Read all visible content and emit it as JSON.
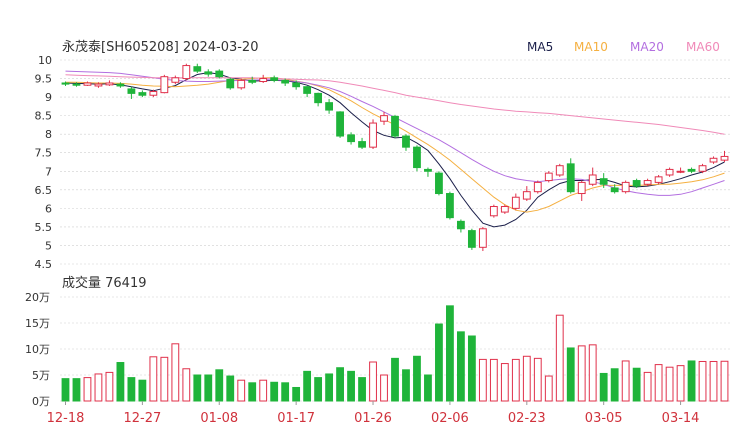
{
  "header": {
    "title": "永茂泰[SH605208] 2024-03-20"
  },
  "legend": [
    {
      "label": "MA5",
      "color": "#1b1f4a"
    },
    {
      "label": "MA10",
      "color": "#f5b041"
    },
    {
      "label": "MA20",
      "color": "#b36fe0"
    },
    {
      "label": "MA60",
      "color": "#f08ab8"
    }
  ],
  "volume_title": "成交量 76419",
  "colors": {
    "up": "#e0304a",
    "down": "#1fb43a",
    "grid": "#cfcfcf",
    "axis_text": "#333333",
    "date_text": "#d0323c"
  },
  "chart_data": [
    {
      "type": "candlestick",
      "ylim": [
        4.5,
        10
      ],
      "y_ticks": [
        "10",
        "9.5",
        "9",
        "8.5",
        "8",
        "7.5",
        "7",
        "6.5",
        "6",
        "5.5",
        "5",
        "4.5"
      ],
      "x_labels": [
        {
          "i": 0,
          "label": "12-18"
        },
        {
          "i": 7,
          "label": "12-27"
        },
        {
          "i": 14,
          "label": "01-08"
        },
        {
          "i": 21,
          "label": "01-17"
        },
        {
          "i": 28,
          "label": "01-26"
        },
        {
          "i": 35,
          "label": "02-06"
        },
        {
          "i": 42,
          "label": "02-23"
        },
        {
          "i": 49,
          "label": "03-05"
        },
        {
          "i": 56,
          "label": "03-14"
        }
      ],
      "candles": [
        [
          9.38,
          9.35,
          9.42,
          9.3
        ],
        [
          9.35,
          9.32,
          9.4,
          9.28
        ],
        [
          9.32,
          9.38,
          9.42,
          9.3
        ],
        [
          9.3,
          9.35,
          9.4,
          9.25
        ],
        [
          9.33,
          9.38,
          9.45,
          9.3
        ],
        [
          9.35,
          9.3,
          9.4,
          9.25
        ],
        [
          9.22,
          9.1,
          9.28,
          8.95
        ],
        [
          9.12,
          9.05,
          9.18,
          9.0
        ],
        [
          9.05,
          9.15,
          9.2,
          9.0
        ],
        [
          9.12,
          9.55,
          9.6,
          9.1
        ],
        [
          9.4,
          9.52,
          9.58,
          9.35
        ],
        [
          9.5,
          9.85,
          9.9,
          9.45
        ],
        [
          9.82,
          9.7,
          9.9,
          9.65
        ],
        [
          9.68,
          9.62,
          9.75,
          9.55
        ],
        [
          9.7,
          9.55,
          9.75,
          9.5
        ],
        [
          9.48,
          9.25,
          9.52,
          9.2
        ],
        [
          9.25,
          9.45,
          9.5,
          9.2
        ],
        [
          9.45,
          9.4,
          9.55,
          9.35
        ],
        [
          9.42,
          9.5,
          9.6,
          9.38
        ],
        [
          9.52,
          9.45,
          9.58,
          9.4
        ],
        [
          9.45,
          9.38,
          9.5,
          9.3
        ],
        [
          9.38,
          9.28,
          9.45,
          9.2
        ],
        [
          9.28,
          9.1,
          9.3,
          9.0
        ],
        [
          9.1,
          8.85,
          9.12,
          8.75
        ],
        [
          8.85,
          8.65,
          8.95,
          8.55
        ],
        [
          8.6,
          7.95,
          8.62,
          7.9
        ],
        [
          7.98,
          7.8,
          8.05,
          7.72
        ],
        [
          7.8,
          7.65,
          7.9,
          7.6
        ],
        [
          7.65,
          8.3,
          8.4,
          7.6
        ],
        [
          8.35,
          8.5,
          8.6,
          8.25
        ],
        [
          8.48,
          7.95,
          8.52,
          7.9
        ],
        [
          7.95,
          7.65,
          8.0,
          7.55
        ],
        [
          7.65,
          7.1,
          7.7,
          7.0
        ],
        [
          7.05,
          7.0,
          7.1,
          6.85
        ],
        [
          6.95,
          6.4,
          7.0,
          6.35
        ],
        [
          6.4,
          5.75,
          6.45,
          5.7
        ],
        [
          5.65,
          5.45,
          5.7,
          5.35
        ],
        [
          5.4,
          4.95,
          5.45,
          4.88
        ],
        [
          4.95,
          5.45,
          5.5,
          4.85
        ],
        [
          5.8,
          6.05,
          6.1,
          5.75
        ],
        [
          5.9,
          6.05,
          6.1,
          5.85
        ],
        [
          6.0,
          6.3,
          6.4,
          5.95
        ],
        [
          6.25,
          6.45,
          6.6,
          6.2
        ],
        [
          6.45,
          6.7,
          6.75,
          6.4
        ],
        [
          6.75,
          6.95,
          7.0,
          6.7
        ],
        [
          6.9,
          7.15,
          7.2,
          6.85
        ],
        [
          7.2,
          6.45,
          7.35,
          6.4
        ],
        [
          6.4,
          6.7,
          6.75,
          6.2
        ],
        [
          6.65,
          6.9,
          7.1,
          6.6
        ],
        [
          6.8,
          6.65,
          6.95,
          6.55
        ],
        [
          6.55,
          6.45,
          6.65,
          6.4
        ],
        [
          6.45,
          6.7,
          6.75,
          6.4
        ],
        [
          6.75,
          6.6,
          6.8,
          6.55
        ],
        [
          6.65,
          6.75,
          6.8,
          6.6
        ],
        [
          6.7,
          6.85,
          6.9,
          6.65
        ],
        [
          6.9,
          7.05,
          7.1,
          6.85
        ],
        [
          7.0,
          7.0,
          7.1,
          6.95
        ],
        [
          7.05,
          7.0,
          7.1,
          6.95
        ],
        [
          7.0,
          7.15,
          7.2,
          6.95
        ],
        [
          7.25,
          7.35,
          7.4,
          7.2
        ],
        [
          7.3,
          7.4,
          7.55,
          7.25
        ]
      ],
      "ma5": [
        9.38,
        9.37,
        9.36,
        9.35,
        9.36,
        9.33,
        9.28,
        9.22,
        9.17,
        9.24,
        9.31,
        9.47,
        9.61,
        9.66,
        9.62,
        9.52,
        9.48,
        9.43,
        9.44,
        9.45,
        9.44,
        9.4,
        9.32,
        9.2,
        9.05,
        8.85,
        8.58,
        8.33,
        8.1,
        7.97,
        7.9,
        7.92,
        7.76,
        7.56,
        7.2,
        6.8,
        6.35,
        5.95,
        5.6,
        5.5,
        5.55,
        5.7,
        5.95,
        6.3,
        6.5,
        6.67,
        6.75,
        6.75,
        6.77,
        6.78,
        6.7,
        6.6,
        6.58,
        6.6,
        6.65,
        6.72,
        6.8,
        6.9,
        6.98,
        7.1,
        7.25
      ],
      "ma10": [
        9.4,
        9.4,
        9.39,
        9.38,
        9.38,
        9.37,
        9.35,
        9.32,
        9.3,
        9.29,
        9.28,
        9.3,
        9.32,
        9.35,
        9.4,
        9.45,
        9.48,
        9.5,
        9.52,
        9.52,
        9.48,
        9.43,
        9.38,
        9.3,
        9.2,
        9.05,
        8.9,
        8.72,
        8.55,
        8.4,
        8.25,
        8.08,
        7.9,
        7.72,
        7.52,
        7.3,
        7.05,
        6.8,
        6.55,
        6.3,
        6.1,
        5.95,
        5.9,
        5.95,
        6.05,
        6.2,
        6.35,
        6.45,
        6.55,
        6.62,
        6.62,
        6.62,
        6.62,
        6.63,
        6.65,
        6.65,
        6.68,
        6.72,
        6.77,
        6.85,
        6.95
      ],
      "ma20": [
        9.7,
        9.69,
        9.68,
        9.67,
        9.66,
        9.64,
        9.6,
        9.56,
        9.52,
        9.48,
        9.45,
        9.43,
        9.42,
        9.42,
        9.43,
        9.44,
        9.45,
        9.46,
        9.47,
        9.47,
        9.45,
        9.42,
        9.38,
        9.32,
        9.25,
        9.15,
        9.02,
        8.88,
        8.75,
        8.6,
        8.45,
        8.3,
        8.15,
        8.0,
        7.85,
        7.68,
        7.5,
        7.32,
        7.15,
        7.0,
        6.88,
        6.8,
        6.75,
        6.72,
        6.75,
        6.78,
        6.8,
        6.78,
        6.72,
        6.65,
        6.55,
        6.48,
        6.42,
        6.38,
        6.35,
        6.35,
        6.38,
        6.45,
        6.55,
        6.65,
        6.75
      ],
      "ma60": [
        9.6,
        9.59,
        9.58,
        9.57,
        9.56,
        9.55,
        9.54,
        9.53,
        9.52,
        9.52,
        9.52,
        9.52,
        9.52,
        9.52,
        9.52,
        9.52,
        9.52,
        9.52,
        9.51,
        9.5,
        9.49,
        9.48,
        9.47,
        9.46,
        9.44,
        9.4,
        9.35,
        9.3,
        9.24,
        9.18,
        9.12,
        9.05,
        9.0,
        8.95,
        8.9,
        8.85,
        8.8,
        8.76,
        8.72,
        8.68,
        8.65,
        8.62,
        8.6,
        8.58,
        8.56,
        8.53,
        8.5,
        8.47,
        8.44,
        8.41,
        8.38,
        8.35,
        8.32,
        8.29,
        8.26,
        8.22,
        8.18,
        8.14,
        8.1,
        8.05,
        8.0
      ]
    },
    {
      "type": "bar",
      "series_name": "成交量",
      "ylim": [
        0,
        200000
      ],
      "y_ticks": [
        "20万",
        "15万",
        "10万",
        "5万",
        "0万"
      ],
      "values": [
        43000,
        43000,
        45000,
        52000,
        55000,
        74000,
        45000,
        40000,
        85000,
        84000,
        110000,
        62000,
        50000,
        50000,
        60000,
        48000,
        40000,
        35000,
        40000,
        36000,
        35000,
        26000,
        57000,
        45000,
        52000,
        64000,
        57000,
        45000,
        75000,
        50000,
        82000,
        60000,
        86000,
        50000,
        148000,
        183000,
        133000,
        125000,
        80000,
        80000,
        72000,
        80000,
        86000,
        82000,
        48000,
        165000,
        102000,
        106000,
        108000,
        53000,
        62000,
        77000,
        63000,
        55000,
        70000,
        65000,
        68000,
        77000,
        76000,
        76000,
        76419
      ]
    }
  ]
}
